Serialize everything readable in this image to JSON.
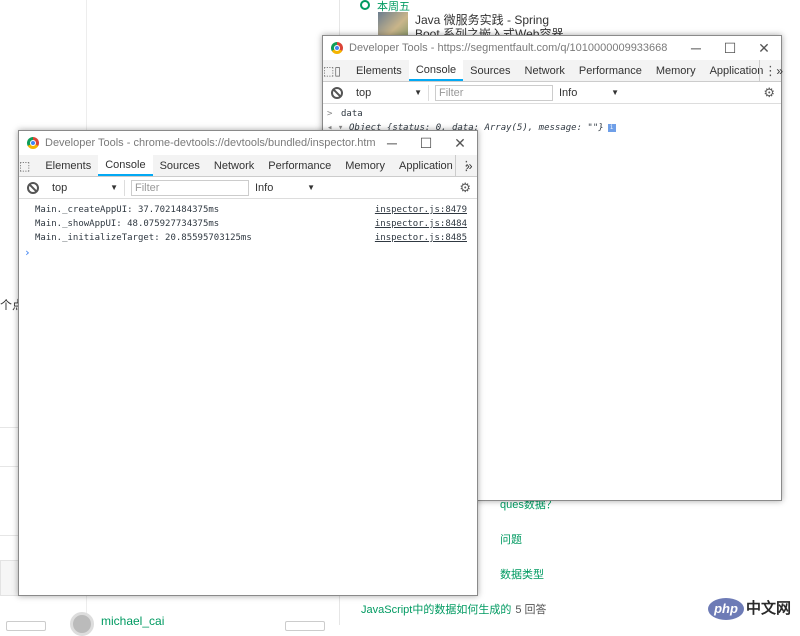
{
  "background": {
    "week_label": "本周五",
    "article_title": "Java 微服务实践 - Spring Boot 系列之嵌入式Web容器",
    "left_fragment": "个点",
    "questions": [
      {
        "text": "ques数据？",
        "count": ""
      },
      {
        "text": "问题",
        "count": ""
      },
      {
        "text": "数据类型",
        "count": ""
      },
      {
        "text": "JavaScript中的数据如何生成的",
        "count": "5 回答"
      }
    ],
    "username": "michael_cai",
    "watermark": {
      "logo": "php",
      "text": "中文网"
    }
  },
  "devtools_back": {
    "title": "Developer Tools - https://segmentfault.com/q/1010000009933668",
    "tabs": [
      "Elements",
      "Console",
      "Sources",
      "Network",
      "Performance",
      "Memory",
      "Application"
    ],
    "active_tab": "Console",
    "more": "»",
    "context": "top",
    "filter_placeholder": "Filter",
    "level": "Info",
    "lines": [
      {
        "prefix": ">",
        "text": "data"
      },
      {
        "prefix": "◂ ▾",
        "text": "Object {status: 0, data: Array(5), message: \"\"}"
      }
    ]
  },
  "devtools_front": {
    "title": "Developer Tools - chrome-devtools://devtools/bundled/inspector.html?rem...",
    "tabs": [
      "Elements",
      "Console",
      "Sources",
      "Network",
      "Performance",
      "Memory",
      "Application"
    ],
    "active_tab": "Console",
    "more": "»",
    "context": "top",
    "filter_placeholder": "Filter",
    "level": "Info",
    "logs": [
      {
        "message": "Main._createAppUI: 37.7021484375ms",
        "source": "inspector.js:8479"
      },
      {
        "message": "Main._showAppUI: 48.075927734375ms",
        "source": "inspector.js:8484"
      },
      {
        "message": "Main._initializeTarget: 20.85595703125ms",
        "source": "inspector.js:8485"
      }
    ],
    "prompt": "›"
  },
  "window_buttons": {
    "minimize": "─",
    "maximize": "☐",
    "close": "✕"
  },
  "colors": {
    "accent_green": "#009a61",
    "tab_active": "#03a9f4"
  }
}
